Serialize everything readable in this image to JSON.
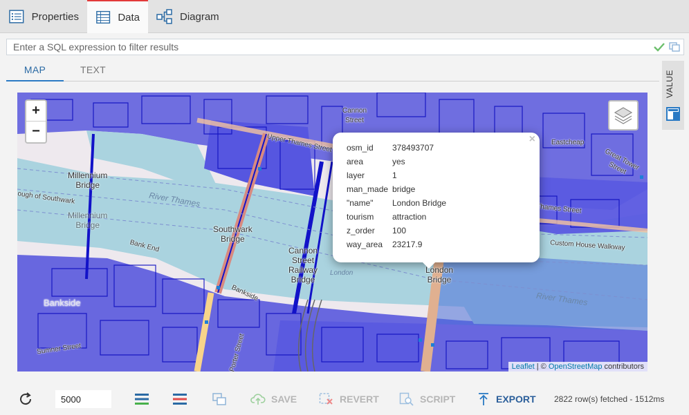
{
  "tabs": [
    {
      "label": "Properties",
      "icon": "properties-icon"
    },
    {
      "label": "Data",
      "icon": "grid-icon"
    },
    {
      "label": "Diagram",
      "icon": "diagram-icon"
    }
  ],
  "filter": {
    "placeholder": "Enter a SQL expression to filter results"
  },
  "subtabs": [
    {
      "label": "MAP"
    },
    {
      "label": "TEXT"
    }
  ],
  "value_panel": {
    "label": "VALUE"
  },
  "map": {
    "labels": {
      "millennium_bridge": "Millennium\nBridge",
      "millennium_bridge_faint": "Millennium\nBridge",
      "southwark_bridge": "Southwark\nBridge",
      "cannon_street_bridge": "Cannon\nStreet\nRailway\nBridge",
      "london_bridge": "London\nBridge",
      "river_thames_1": "River Thames",
      "river_thames_2": "River Thames",
      "bankside": "Bankside",
      "upper_thames_street": "Upper Thames Street",
      "thames_street": "Thames Street",
      "great_tower_street": "Great Tower Street",
      "eastcheap": "Eastcheap",
      "custom_house_walkway": "Custom House Walkway",
      "sumner_street": "Sumner Street",
      "porter_street": "Porter Street",
      "borough_of_southwark": "ough of Southwark",
      "cannon_street": "Cannon\nStreet",
      "london": "London",
      "bankside_small": "Bankside",
      "bank_end": "Bank End"
    },
    "zoom_in": "+",
    "zoom_out": "−",
    "attribution": {
      "leaflet": "Leaflet",
      "sep": " | © ",
      "osm": "OpenStreetMap",
      "rest": " contributors"
    }
  },
  "popup": {
    "close": "×",
    "rows": [
      {
        "key": "osm_id",
        "value": "378493707"
      },
      {
        "key": "area",
        "value": "yes"
      },
      {
        "key": "layer",
        "value": "1"
      },
      {
        "key": "man_made",
        "value": "bridge"
      },
      {
        "key": "\"name\"",
        "value": "London Bridge"
      },
      {
        "key": "tourism",
        "value": "attraction"
      },
      {
        "key": "z_order",
        "value": "100"
      },
      {
        "key": "way_area",
        "value": "23217.9"
      }
    ]
  },
  "toolbar": {
    "max_rows": "5000",
    "save": "SAVE",
    "revert": "REVERT",
    "script": "SCRIPT",
    "export": "EXPORT",
    "status": "2822 row(s) fetched - 1512ms"
  },
  "colors": {
    "accent": "#2a7ac4",
    "active_tab_border": "#e23a3a",
    "overlay": "#2b2bd6",
    "water": "#aad3df"
  }
}
